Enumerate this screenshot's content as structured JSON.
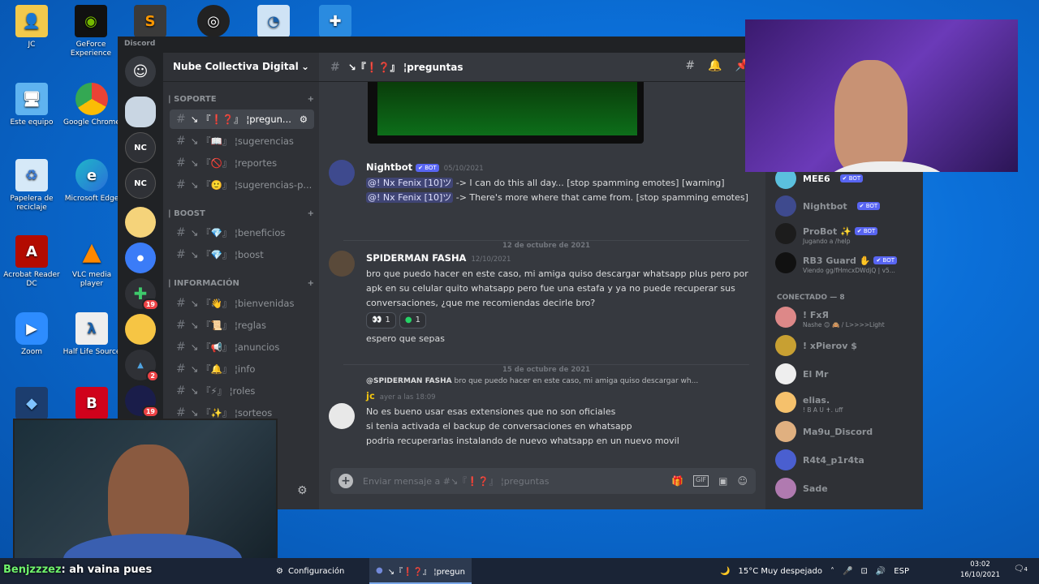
{
  "desktop": {
    "icons_top": [
      "JC",
      "GeForce Experience",
      "",
      "",
      "",
      ""
    ],
    "icons_left": [
      {
        "label": "Este equipo"
      },
      {
        "label": "Google Chrome"
      },
      {
        "label": "Papelera de reciclaje"
      },
      {
        "label": "Microsoft Edge"
      },
      {
        "label": "Acrobat Reader DC"
      },
      {
        "label": "VLC media player"
      },
      {
        "label": "Zoom"
      },
      {
        "label": "Half Life Source"
      }
    ]
  },
  "discord": {
    "app_title": "Discord",
    "server_name": "Nube Collectiva Digital",
    "guild_badges": [
      "19",
      "2",
      "19"
    ],
    "categories": [
      {
        "label": "| SOPORTE"
      },
      {
        "label": "| BOOST"
      },
      {
        "label": "| INFORMACIÓN"
      }
    ],
    "channels": [
      "↘ 『❗❓』 ¦pregun...",
      "↘ 『📖』 ¦sugerencias",
      "↘ 『🚫』 ¦reportes",
      "↘ 『🙂』 ¦sugerencias-p...",
      "↘ 『💎』 ¦beneficios",
      "↘ 『💎』 ¦boost",
      "↘ 『👋』 ¦bienvenidas",
      "↘ 『📜』 ¦reglas",
      "↘ 『📢』 ¦anuncios",
      "↘ 『🔔』 ¦info",
      "↘ 『⚡』 ¦roles",
      "↘ 『✨』 ¦sorteos"
    ],
    "channel_title": "↘『❗❓』 ¦preguntas",
    "messages": {
      "nightbot": {
        "author": "Nightbot",
        "tag": "✔ BOT",
        "time": "05/10/2021",
        "line1_mention": "@! Nx Fenix [10]ツ",
        "line1_text": " -> I can do this all day... [stop spamming emotes] [warning]",
        "line2_mention": "@! Nx Fenix [10]ツ",
        "line2_text": " -> There's more where that came from. [stop spamming emotes]"
      },
      "divider1": "12 de octubre de 2021",
      "spider": {
        "author": "SPIDERMAN FASHA",
        "time": "12/10/2021",
        "text": "bro que puedo hacer en este caso, mi amiga quiso descargar whatsapp plus pero por apk en su celular quito whatsapp pero fue una estafa y ya no puede recuperar sus conversaciones, ¿que me recomiendas decirle bro?",
        "reaction1": "1",
        "reaction2": "1",
        "followup": "espero que sepas"
      },
      "divider2": "15 de octubre de 2021",
      "jc": {
        "reply_author": "@SPIDERMAN FASHA",
        "reply_text": "bro que puedo hacer en este caso, mi amiga quiso descargar wh...",
        "author": "jc",
        "time": "ayer a las 18:09",
        "line1": "No es bueno usar esas extensiones que no son oficiales",
        "line2": "si tenia activada el backup de conversaciones en whatsapp",
        "line3": "podria recuperarlas instalando de nuevo whatsapp en un nuevo movil"
      }
    },
    "input_placeholder": "Enviar mensaje a #↘『❗❓』 ¦preguntas",
    "gif_label": "GIF",
    "members": {
      "bots": [
        {
          "name": "MEE6",
          "tag": "✔ BOT",
          "sub": ""
        },
        {
          "name": "Nightbot",
          "tag": "✔ BOT",
          "sub": ""
        },
        {
          "name": "ProBot ✨",
          "tag": "✔ BOT",
          "sub": "Jugando a /help"
        },
        {
          "name": "RB3 Guard ✋",
          "tag": "✔ BOT",
          "sub": "Viendo gg/fHmcxDWdjQ | v5..."
        }
      ],
      "online_header": "CONECTADO — 8",
      "online": [
        {
          "name": "! FxЯ",
          "sub": "Nashe 😊 🙈 / L>>>>Light"
        },
        {
          "name": "! xPierov $",
          "sub": ""
        },
        {
          "name": "El Mr",
          "sub": ""
        },
        {
          "name": "elias.",
          "sub": "! B A U ✝. uff"
        },
        {
          "name": "Ma9u_Discord",
          "sub": ""
        },
        {
          "name": "R4t4_p1r4ta",
          "sub": ""
        },
        {
          "name": "Sade",
          "sub": ""
        }
      ]
    }
  },
  "overlay": {
    "user": "Benjzzzez",
    "text": ": ah vaina pues"
  },
  "taskbar": {
    "item1": "Configuración",
    "item2": "↘『❗❓』 ¦preguntas - ...",
    "weather": "15°C  Muy despejado",
    "lang": "ESP",
    "time": "03:02",
    "date": "16/10/2021",
    "notif": "4"
  }
}
